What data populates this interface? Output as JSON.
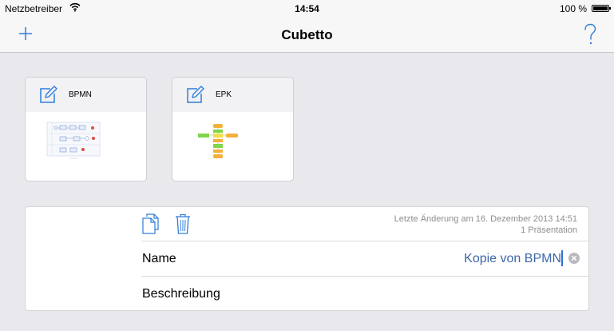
{
  "status_bar": {
    "carrier": "Netzbetreiber",
    "time": "14:54",
    "battery_percent": "100 %"
  },
  "nav": {
    "title": "Cubetto",
    "add_icon": "plus-icon",
    "help_icon": "question-mark-icon"
  },
  "documents": [
    {
      "title": "BPMN",
      "icon": "edit-icon"
    },
    {
      "title": "EPK",
      "icon": "edit-icon"
    }
  ],
  "detail": {
    "last_modified": "Letzte Änderung am 16. Dezember 2013 14:51",
    "presentations": "1 Präsentation",
    "name_label": "Name",
    "name_value": "Kopie von BPMN",
    "description_label": "Beschreibung",
    "description_value": "",
    "copy_icon": "duplicate-icon",
    "trash_icon": "trash-icon",
    "clear_icon": "clear-icon"
  },
  "colors": {
    "accent": "#2f7dd9",
    "text_value": "#3c66a8",
    "secondary_text": "#8e8e93",
    "background": "#e9e9ed"
  }
}
